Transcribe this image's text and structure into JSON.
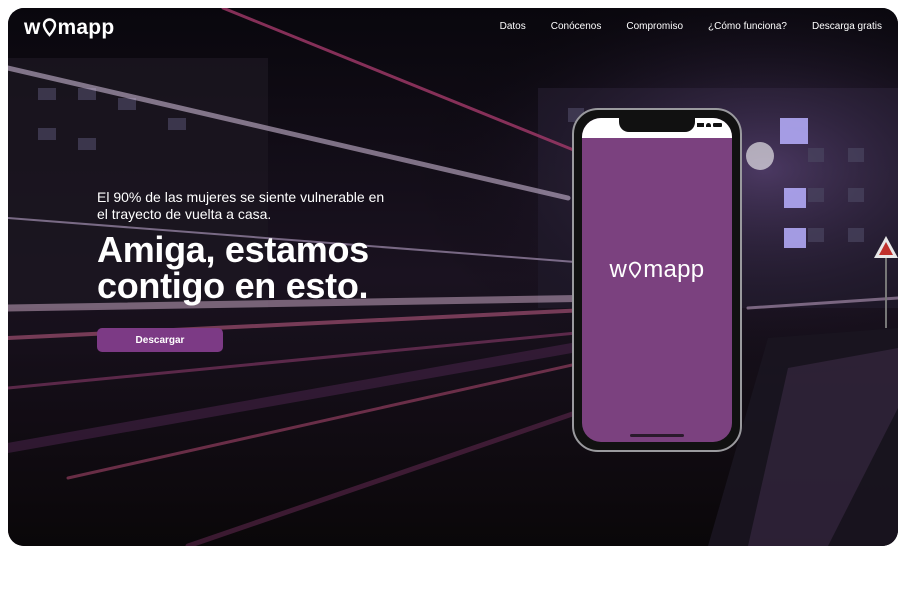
{
  "brand": {
    "logo_prefix": "w",
    "logo_suffix": "mapp",
    "accent": "#7c3a85"
  },
  "nav": {
    "items": [
      {
        "label": "Datos"
      },
      {
        "label": "Conócenos"
      },
      {
        "label": "Compromiso"
      },
      {
        "label": "¿Cómo funciona?"
      },
      {
        "label": "Descarga gratis"
      }
    ]
  },
  "hero": {
    "subtitle": "El 90% de las mujeres se siente vulnerable en el trayecto de vuelta a casa.",
    "headline": "Amiga, estamos contigo en esto.",
    "cta_label": "Descargar"
  },
  "phone": {
    "screen_color": "#7b417f",
    "app_logo_prefix": "w",
    "app_logo_suffix": "mapp"
  }
}
